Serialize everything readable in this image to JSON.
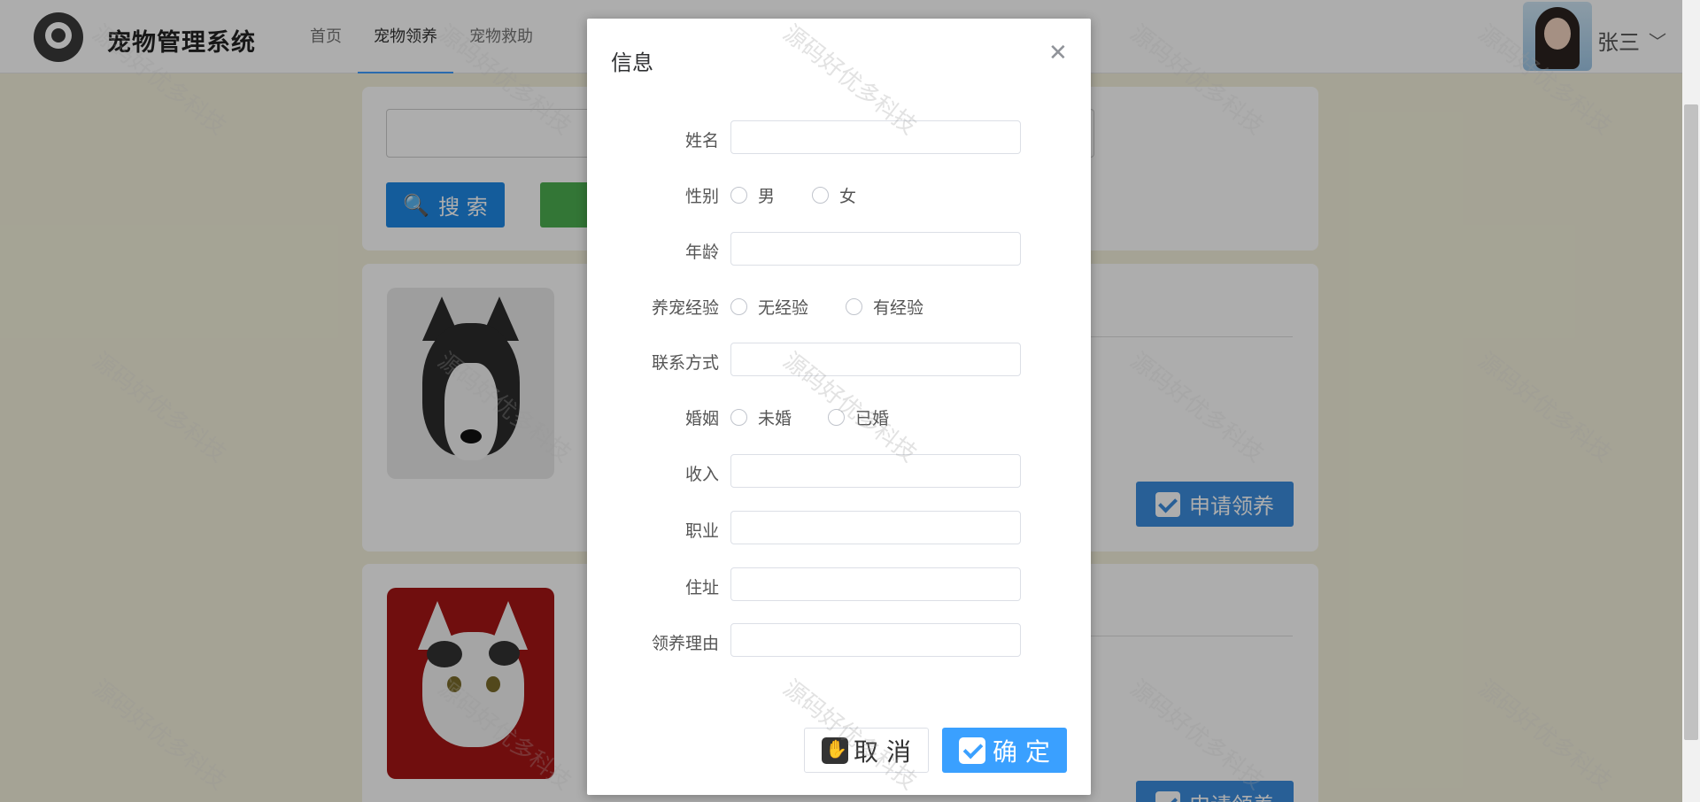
{
  "header": {
    "app_title": "宠物管理系统",
    "nav": [
      "首页",
      "宠物领养",
      "宠物救助"
    ],
    "active_nav": "宠物领养",
    "user_name": "张三"
  },
  "search": {
    "placeholder": "",
    "search_label": "搜 索"
  },
  "cards": {
    "apply_label": "申请领养"
  },
  "dialog": {
    "title": "信息",
    "fields": {
      "name": "姓名",
      "gender": "性别",
      "age": "年龄",
      "experience": "养宠经验",
      "contact": "联系方式",
      "marriage": "婚姻",
      "income": "收入",
      "job": "职业",
      "address": "住址",
      "reason": "领养理由"
    },
    "options": {
      "male": "男",
      "female": "女",
      "no_experience": "无经验",
      "has_experience": "有经验",
      "unmarried": "未婚",
      "married": "已婚"
    },
    "cancel_label": "取 消",
    "ok_label": "确 定"
  },
  "watermark": "源码好优多科技",
  "colors": {
    "primary": "#3aa0ff",
    "search_button": "#1e88e5",
    "apply_button": "#3c8dde",
    "success": "#4caf50"
  }
}
